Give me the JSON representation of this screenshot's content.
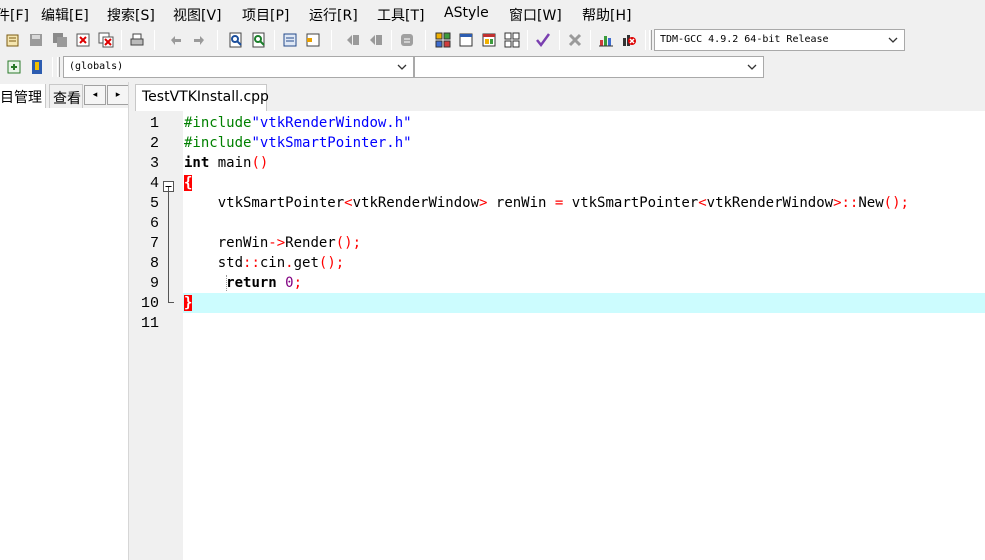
{
  "menu": [
    "件[F]",
    "编辑[E]",
    "搜索[S]",
    "视图[V]",
    "项目[P]",
    "运行[R]",
    "工具[T]",
    "AStyle",
    "窗口[W]",
    "帮助[H]"
  ],
  "toolbar": {
    "compiler_select": "TDM-GCC 4.9.2 64-bit Release",
    "scope_select": "(globals)",
    "symbol_select": ""
  },
  "left_panel": {
    "tab_project": "目管理",
    "tab_view": "查看",
    "scroll_left": "◂",
    "scroll_right": "▸"
  },
  "editor": {
    "file_tab": "TestVTKInstall.cpp",
    "current_line": 10,
    "lines": [
      {
        "num": "1"
      },
      {
        "num": "2"
      },
      {
        "num": "3"
      },
      {
        "num": "4"
      },
      {
        "num": "5"
      },
      {
        "num": "6"
      },
      {
        "num": "7"
      },
      {
        "num": "8"
      },
      {
        "num": "9"
      },
      {
        "num": "10"
      },
      {
        "num": "11"
      }
    ],
    "tokens": {
      "l1_pp": "#include",
      "l1_str": "\"vtkRenderWindow.h\"",
      "l2_pp": "#include",
      "l2_str": "\"vtkSmartPointer.h\"",
      "l3_kw": "int",
      "l3_name": " main",
      "l3_sym": "()",
      "l4_brace": "{",
      "l5_a": "    vtkSmartPointer",
      "l5_b": "<",
      "l5_c": "vtkRenderWindow",
      "l5_d": ">",
      "l5_e": " renWin ",
      "l5_f": "=",
      "l5_g": " vtkSmartPointer",
      "l5_h": "<",
      "l5_i": "vtkRenderWindow",
      "l5_j": ">::",
      "l5_k": "New",
      "l5_l": "();",
      "l7_a": "    renWin",
      "l7_b": "->",
      "l7_c": "Render",
      "l7_d": "();",
      "l8_a": "    std",
      "l8_b": "::",
      "l8_c": "cin",
      "l8_d": ".",
      "l8_e": "get",
      "l8_f": "();",
      "l9_indent": "     ",
      "l9_kw": "return",
      "l9_sp": " ",
      "l9_num": "0",
      "l9_sym": ";",
      "l10_brace": "}"
    }
  },
  "icons": {
    "toolbar1": [
      "open-project-icon",
      "save-icon",
      "save-all-icon",
      "close-icon",
      "close-all-icon",
      "print-icon",
      "undo-icon",
      "redo-icon",
      "find-icon",
      "replace-icon",
      "goto-line-icon",
      "bookmark-icon",
      "indent-icon",
      "unindent-icon",
      "toggle-comment-icon",
      "compile-icon",
      "run-icon",
      "compile-run-icon",
      "rebuild-icon",
      "syntax-check-icon",
      "stop-icon",
      "profile-icon",
      "debug-icon"
    ],
    "toolbar2": [
      "new-class-icon",
      "insert-icon"
    ]
  },
  "colors": {
    "current_line": "#ccfcfe",
    "preprocessor": "#008000",
    "string": "#0000ff",
    "symbol": "#ff0000",
    "number": "#800080"
  }
}
